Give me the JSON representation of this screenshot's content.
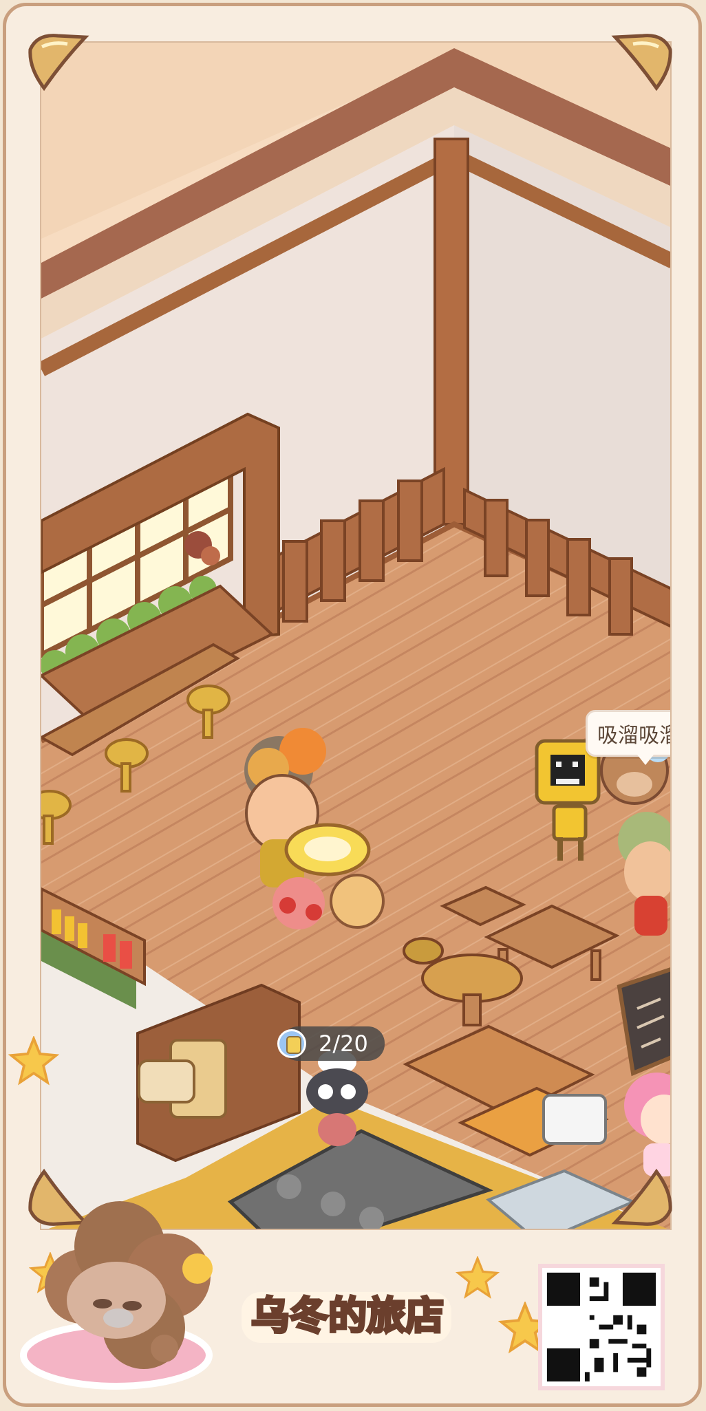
{
  "game": {
    "title": "乌冬的旅店"
  },
  "scene": {
    "speech_bubble": "吸溜吸溜",
    "task_counter": "2/20",
    "icons": [
      "corner-tab-icon",
      "star-icon",
      "jar-icon",
      "qr-code"
    ]
  },
  "colors": {
    "frame": "#f8ede0",
    "border": "#c99f7e",
    "floor": "#d59d70",
    "wood": "#a7673c"
  }
}
